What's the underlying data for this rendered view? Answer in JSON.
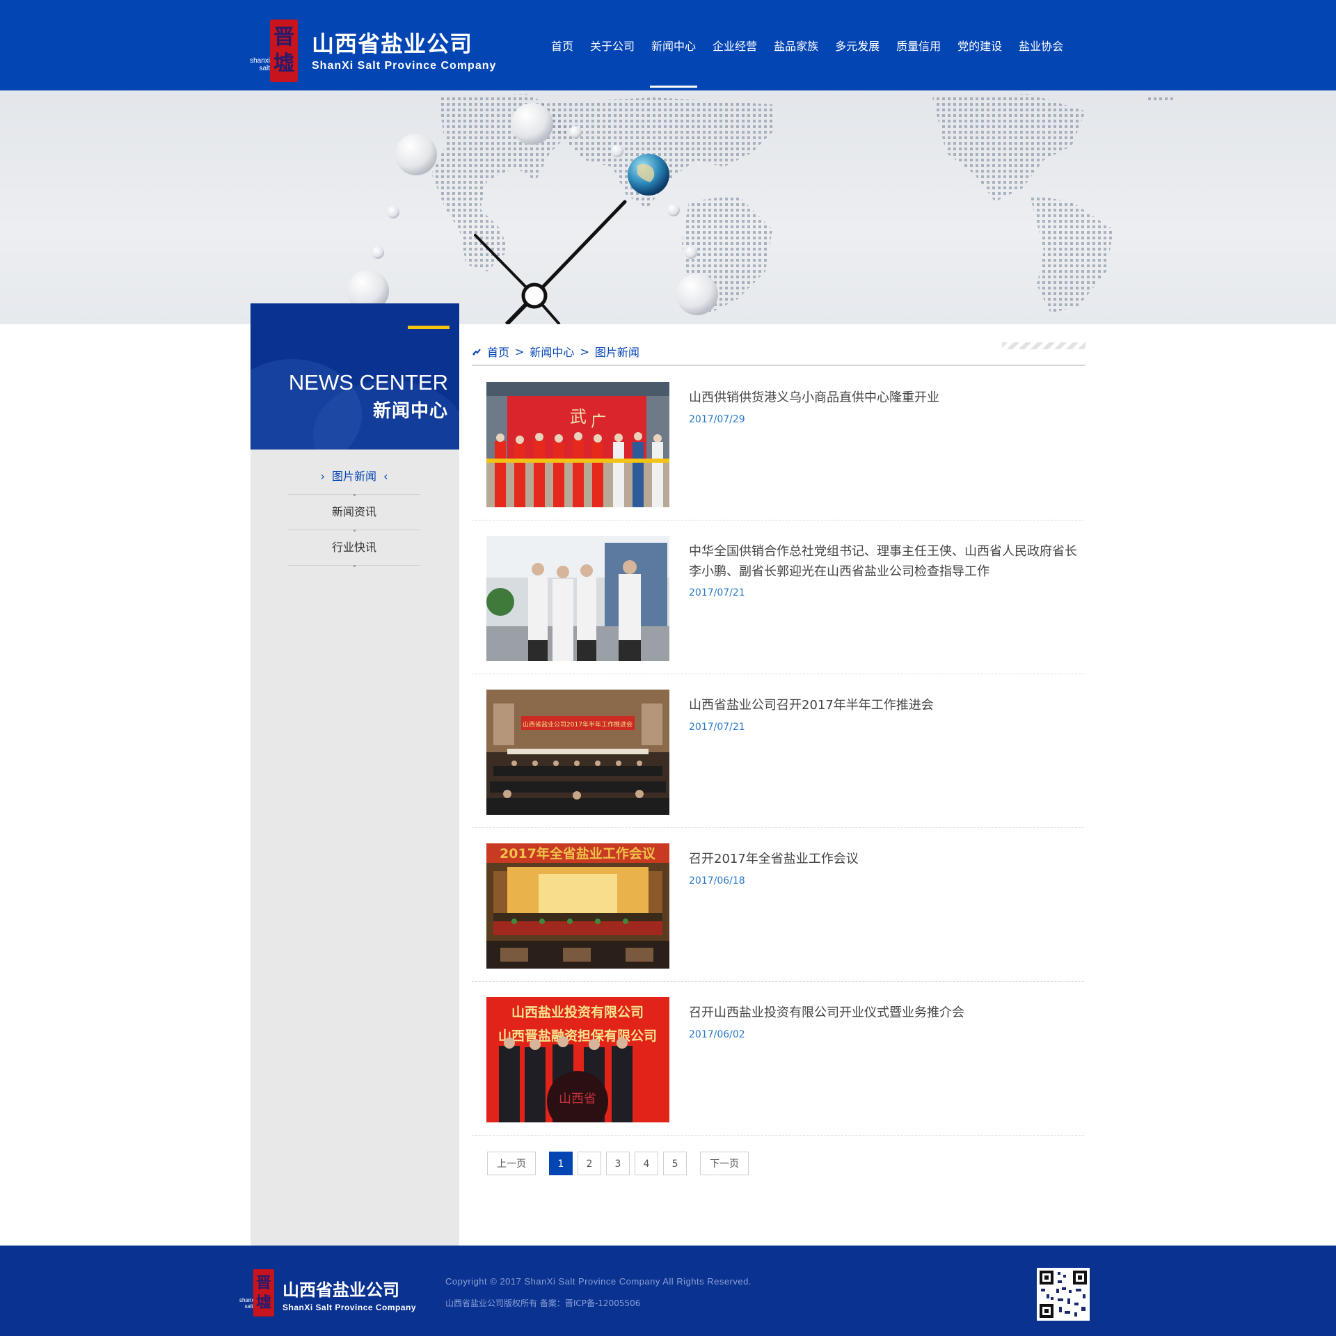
{
  "header": {
    "logo_cn": "山西省盐业公司",
    "logo_en": "ShanXi Salt Province Company",
    "logo_seal_glyphs": [
      "晋",
      "墟"
    ],
    "logo_seal_side": [
      "shanxi",
      "salt"
    ],
    "nav": [
      {
        "label": "首页",
        "active": false
      },
      {
        "label": "关于公司",
        "active": false
      },
      {
        "label": "新闻中心",
        "active": true
      },
      {
        "label": "企业经营",
        "active": false
      },
      {
        "label": "盐品家族",
        "active": false
      },
      {
        "label": "多元发展",
        "active": false
      },
      {
        "label": "质量信用",
        "active": false
      },
      {
        "label": "党的建设",
        "active": false
      },
      {
        "label": "盐业协会",
        "active": false
      }
    ]
  },
  "sidebar": {
    "title_en": "NEWS CENTER",
    "title_cn": "新闻中心",
    "items": [
      {
        "label": "图片新闻",
        "active": true
      },
      {
        "label": "新闻资讯",
        "active": false
      },
      {
        "label": "行业快讯",
        "active": false
      }
    ]
  },
  "breadcrumb": {
    "home": "首页",
    "sep": ">",
    "level1": "新闻中心",
    "level2": "图片新闻"
  },
  "news": [
    {
      "title": "山西供销供货港义乌小商品直供中心隆重开业",
      "date": "2017/07/29",
      "thumb": "ribbon-cutting"
    },
    {
      "title": "中华全国供销合作总社党组书记、理事主任王侠、山西省人民政府省长李小鹏、副省长郭迎光在山西省盐业公司检查指导工作",
      "date": "2017/07/21",
      "thumb": "inspection"
    },
    {
      "title": "山西省盐业公司召开2017年半年工作推进会",
      "date": "2017/07/21",
      "thumb": "meeting-hall"
    },
    {
      "title": "召开2017年全省盐业工作会议",
      "date": "2017/06/18",
      "thumb": "conference-stage"
    },
    {
      "title": "召开山西盐业投资有限公司开业仪式暨业务推介会",
      "date": "2017/06/02",
      "thumb": "opening-ceremony"
    }
  ],
  "thumb_text": {
    "meeting_banner": "山西省盐业公司2017年半年工作推进会",
    "conference_banner": "2017年全省盐业工作会议",
    "opening_line1": "山西盐业投资有限公司",
    "opening_line2": "山西晋盐融资担保有限公司",
    "opening_ball": "山西省"
  },
  "pagination": {
    "prev": "上一页",
    "next": "下一页",
    "pages": [
      "1",
      "2",
      "3",
      "4",
      "5"
    ],
    "current": "1"
  },
  "footer": {
    "logo_cn": "山西省盐业公司",
    "logo_en": "ShanXi Salt Province Company",
    "copyright": "Copyright © 2017 ShanXi Salt Province Company All Rights Reserved.",
    "icp": "山西省盐业公司版权所有   备案：晋ICP备-12005506"
  },
  "colors": {
    "brand_blue": "#0445b4",
    "dark_blue": "#0a3290",
    "accent_yellow": "#f4c40f",
    "seal_red": "#c8141c",
    "date_blue": "#2a79c8"
  }
}
